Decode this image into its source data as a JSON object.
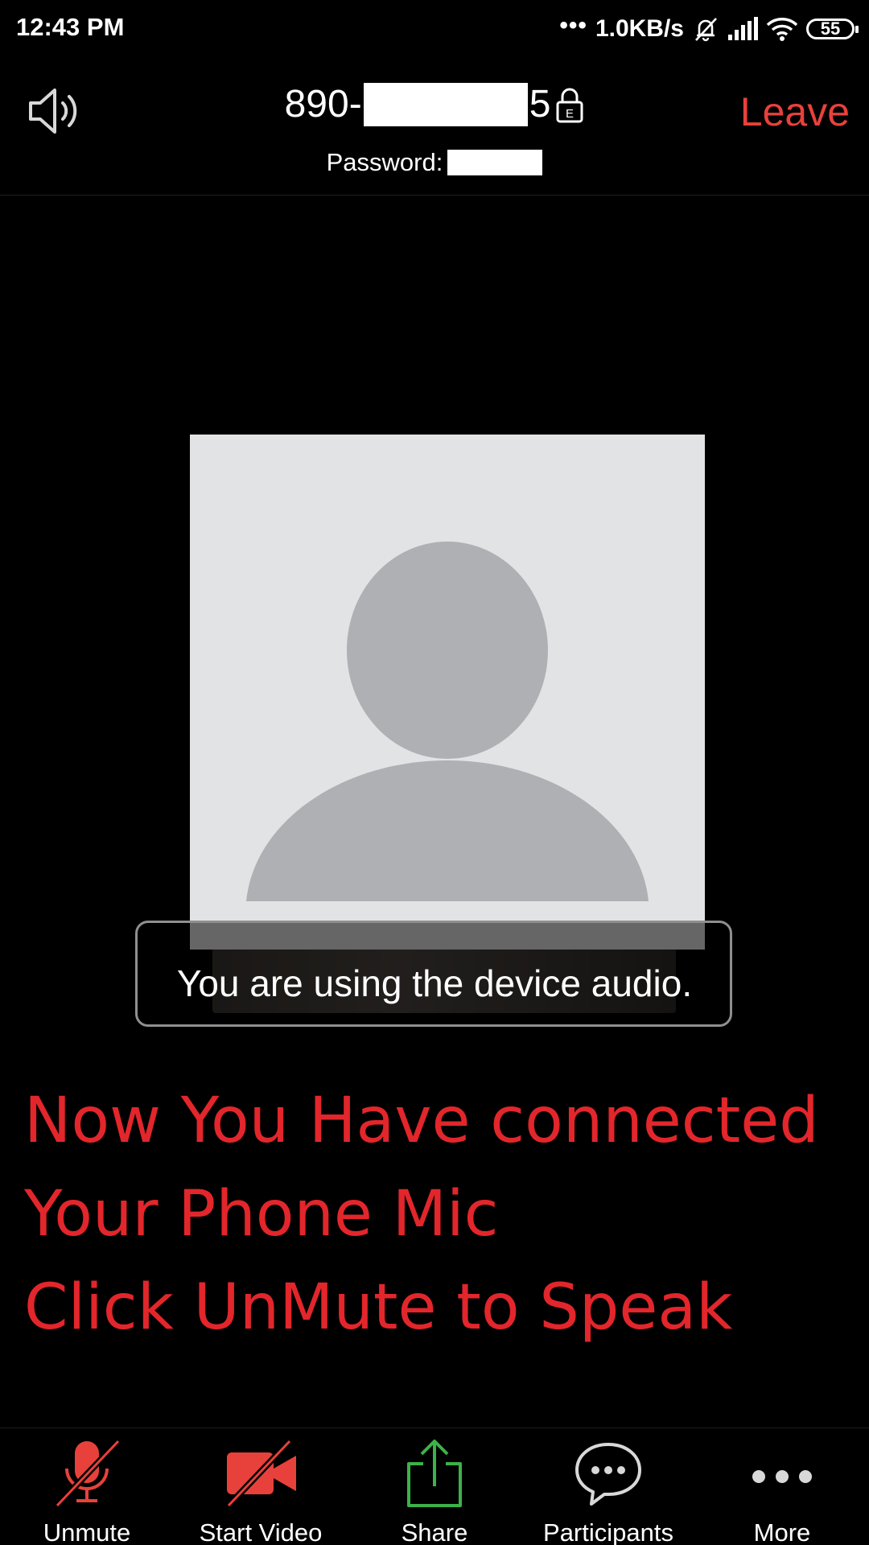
{
  "status_bar": {
    "time": "12:43 PM",
    "dots": "•••",
    "net_speed": "1.0KB/s",
    "battery": "55"
  },
  "header": {
    "meeting_id_prefix": "890-",
    "meeting_id_suffix": "5",
    "password_label": "Password:",
    "leave_label": "Leave"
  },
  "video": {
    "toast_text": "You are using the device audio."
  },
  "overlay": {
    "lines": [
      "Now You Have connected",
      "Your Phone Mic",
      "Click UnMute to Speak"
    ]
  },
  "toolbar": {
    "unmute_label": "Unmute",
    "start_video_label": "Start Video",
    "share_label": "Share",
    "participants_label": "Participants",
    "more_label": "More"
  },
  "colors": {
    "leave": "#e8413b",
    "overlay_text": "#e2262b",
    "muted_icon": "#e8413b",
    "share_icon": "#3cb24a",
    "avatar_bg": "#e2e3e5",
    "avatar_silhouette": "#aeb0b4"
  },
  "icons": {
    "speaker": "speaker-icon",
    "lock": "lock-icon",
    "mic_off": "mic-off-icon",
    "video_off": "video-off-icon",
    "share": "share-icon",
    "participants": "chat-bubble-icon",
    "more": "more-dots-icon"
  }
}
